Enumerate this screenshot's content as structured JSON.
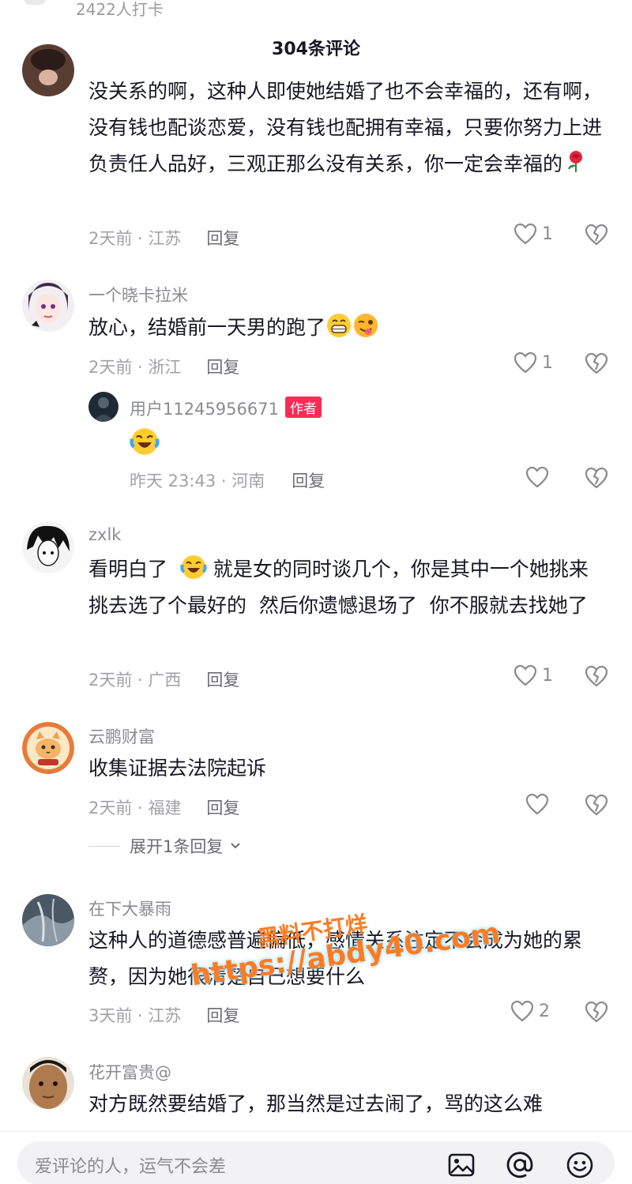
{
  "top": {
    "checkin_text": "2422人打卡"
  },
  "header": {
    "title": "304条评论"
  },
  "comments": [
    {
      "username": "",
      "content": "没关系的啊，这种人即使她结婚了也不会幸福的，还有啊，没有钱也配谈恋爱，没有钱也配拥有幸福，只要你努力上进负责任人品好，三观正那么没有关系，你一定会幸福的",
      "emoji": [
        "rose"
      ],
      "time": "2天前 · 江苏",
      "reply_label": "回复",
      "likes": "1"
    },
    {
      "username": "一个晓卡拉米",
      "content": "放心，结婚前一天男的跑了",
      "emoji": [
        "grin",
        "wink-tongue"
      ],
      "time": "2天前 · 浙江",
      "reply_label": "回复",
      "likes": "1",
      "reply": {
        "username": "用户11245956671",
        "badge": "作者",
        "content_emoji": [
          "laugh-cry"
        ],
        "time": "昨天 23:43 · 河南",
        "reply_label": "回复",
        "likes": ""
      }
    },
    {
      "username": "zxlk",
      "content_before": "看明白了  ",
      "content_after": " 就是女的同时谈几个，你是其中一个她挑来挑去选了个最好的  然后你遗憾退场了  你不服就去找她了",
      "emoji": [
        "laugh-cry"
      ],
      "time": "2天前 · 广西",
      "reply_label": "回复",
      "likes": "1"
    },
    {
      "username": "云鹏财富",
      "content": "收集证据去法院起诉",
      "time": "2天前 · 福建",
      "reply_label": "回复",
      "likes": "",
      "expand_label": "展开1条回复"
    },
    {
      "username": "在下大暴雨",
      "content": "这种人的道德感普遍偏低，感情关系注定不会成为她的累赘，因为她很清楚自己想要什么",
      "time": "3天前 · 江苏",
      "reply_label": "回复",
      "likes": "2"
    },
    {
      "username": "花开富贵@",
      "content": "对方既然要结婚了，那当然是过去闹了，骂的这么难",
      "time": "",
      "reply_label": "",
      "likes": ""
    }
  ],
  "watermark": {
    "line1": "黑料不打烊",
    "line2": "https://abdy40.com"
  },
  "input": {
    "placeholder": "爱评论的人，运气不会差"
  },
  "icons": {
    "like": "heart-outline-icon",
    "dislike": "broken-heart-icon",
    "image": "image-icon",
    "mention": "at-icon",
    "emoji": "smiley-icon"
  },
  "colors": {
    "badge": "#fe2c55",
    "text": "#161823",
    "muted": "#8a8b91"
  }
}
